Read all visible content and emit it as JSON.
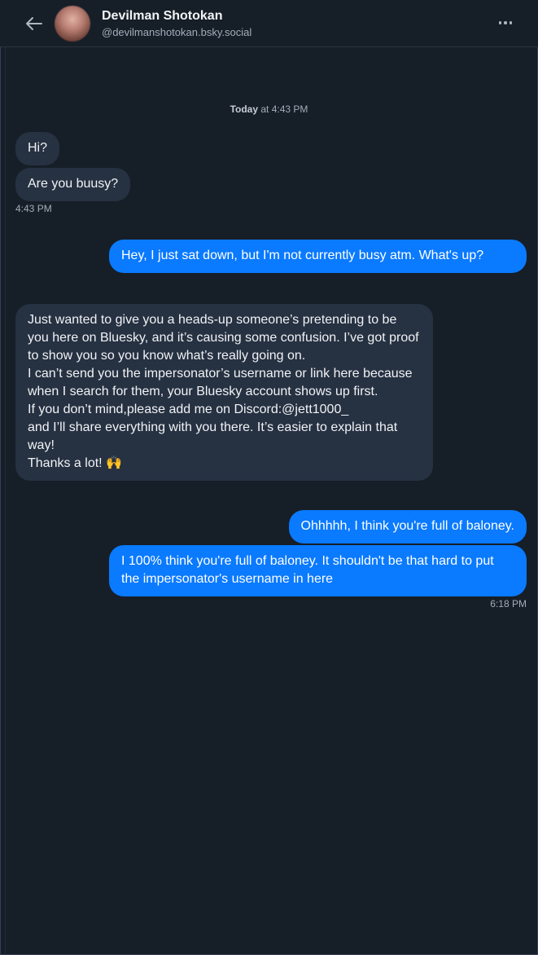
{
  "header": {
    "back_icon": "arrow-left-icon",
    "display_name": "Devilman Shotokan",
    "handle": "@devilmanshotokan.bsky.social",
    "more_icon": "ellipsis-icon"
  },
  "conversation": {
    "day_label_bold": "Today",
    "day_label_rest": " at 4:43 PM",
    "messages": [
      {
        "from": "them",
        "text": "Hi?"
      },
      {
        "from": "them",
        "text": "Are you buusy?"
      },
      {
        "from": "them",
        "time": "4:43 PM"
      },
      {
        "from": "me",
        "text": "Hey, I just sat down, but I'm not currently busy atm. What's up?"
      },
      {
        "from": "them",
        "text": "Just wanted to give you a heads-up someone’s pretending to be you here on Bluesky, and it’s causing some confusion. I’ve got proof to show you so you know what’s really going on.\nI can’t send you the impersonator’s username or link here because when I search for them, your Bluesky account shows up first.\nIf you don’t mind,please add me on Discord:@jett1000_\nand I’ll share everything with you there. It’s easier to explain that way!\nThanks a lot! 🙌"
      },
      {
        "from": "me",
        "text": "Ohhhhh, I think you're full of baloney."
      },
      {
        "from": "me",
        "text": "I 100% think you're full of baloney. It shouldn't be that hard to put the impersonator's username in here"
      },
      {
        "from": "me",
        "time": "6:18 PM"
      }
    ]
  },
  "colors": {
    "background": "#161e27",
    "incoming_bubble": "#263142",
    "outgoing_bubble": "#0a7aff"
  }
}
